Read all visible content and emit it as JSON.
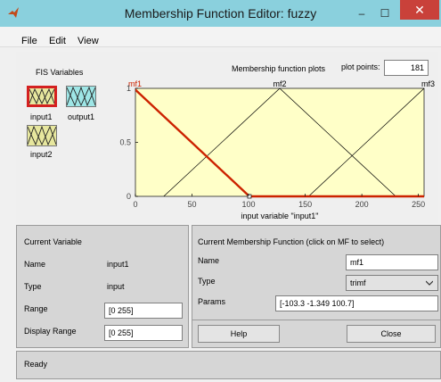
{
  "window": {
    "title": "Membership Function Editor: fuzzy",
    "minimize": "–",
    "maximize": "☐",
    "close": "✕"
  },
  "menu": {
    "file": "File",
    "edit": "Edit",
    "view": "View"
  },
  "fis": {
    "heading": "FIS Variables",
    "variables": [
      {
        "label": "input1",
        "color": "#e7e79e",
        "selected": true
      },
      {
        "label": "output1",
        "color": "#9ee6e6",
        "selected": false
      },
      {
        "label": "input2",
        "color": "#e7e79e",
        "selected": false
      }
    ]
  },
  "plot": {
    "title": "Membership function plots",
    "plot_points_label": "plot points:",
    "plot_points_value": "181",
    "xlabel": "input variable \"input1\"",
    "colors": {
      "background": "#ffffc8",
      "selected": "#cc2200",
      "normal": "#000000"
    }
  },
  "chart_data": {
    "type": "line",
    "xlim": [
      0,
      255
    ],
    "ylim": [
      0,
      1
    ],
    "x_ticks": [
      "0",
      "50",
      "100",
      "150",
      "200",
      "250"
    ],
    "y_ticks": [
      "0",
      "0.5",
      "1"
    ],
    "series": [
      {
        "name": "mf1",
        "selected": true,
        "x": [
          -103.3,
          -1.349,
          100.7
        ],
        "y": [
          0,
          1,
          0
        ]
      },
      {
        "name": "mf2",
        "selected": false,
        "x": [
          25,
          127.5,
          230
        ],
        "y": [
          0,
          1,
          0
        ]
      },
      {
        "name": "mf3",
        "selected": false,
        "x": [
          153,
          255,
          357
        ],
        "y": [
          0,
          1,
          0
        ]
      }
    ]
  },
  "current_variable": {
    "heading": "Current Variable",
    "name_label": "Name",
    "name_value": "input1",
    "type_label": "Type",
    "type_value": "input",
    "range_label": "Range",
    "range_value": "[0 255]",
    "display_range_label": "Display Range",
    "display_range_value": "[0 255]"
  },
  "current_mf": {
    "heading": "Current Membership Function (click on MF to select)",
    "name_label": "Name",
    "name_value": "mf1",
    "type_label": "Type",
    "type_value": "trimf",
    "params_label": "Params",
    "params_value": "[-103.3 -1.349 100.7]"
  },
  "buttons": {
    "help": "Help",
    "close": "Close"
  },
  "status": "Ready"
}
